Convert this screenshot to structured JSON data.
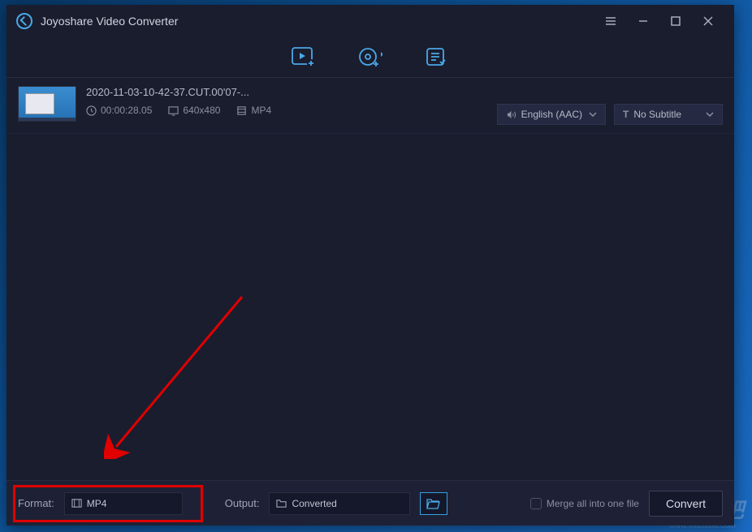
{
  "app": {
    "title": "Joyoshare Video Converter"
  },
  "file": {
    "name": "2020-11-03-10-42-37.CUT.00'07-...",
    "duration": "00:00:28.05",
    "resolution": "640x480",
    "format": "MP4",
    "audio": "English (AAC)",
    "subtitle": "No Subtitle"
  },
  "bottom": {
    "format_label": "Format:",
    "format_value": "MP4",
    "output_label": "Output:",
    "output_value": "Converted",
    "merge_label": "Merge all into one file",
    "convert_label": "Convert"
  },
  "watermark": {
    "main": "下载吧",
    "sub": "www.xiazaiba.com"
  }
}
